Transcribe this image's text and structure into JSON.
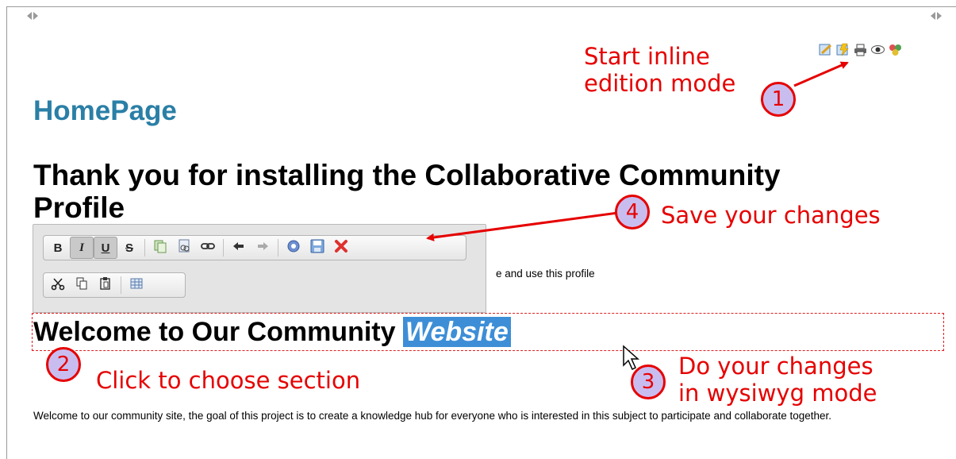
{
  "page": {
    "title": "HomePage",
    "heading1_line1": "Thank you for installing the Collaborative Community",
    "heading1_line2": "Profile",
    "paragraph1": "e and use this profile",
    "heading2": "Welcome to Our Community ",
    "heading2_highlight": "Website",
    "paragraph2": "Welcome to our community site, the goal of this project is to create a knowledge hub for everyone who is interested in this subject to participate and collaborate together."
  },
  "icons": {
    "collapse_left": "collapse-left-icon",
    "collapse_right": "collapse-right-icon",
    "page_actions": [
      "edit-icon",
      "inline-edit-icon",
      "print-icon",
      "view-icon",
      "tags-icon"
    ]
  },
  "toolbar": {
    "row1": [
      "B",
      "I",
      "U",
      "S"
    ],
    "row1_icons": [
      "copy-format-icon",
      "insert-image-icon",
      "link-icon",
      "undo-icon",
      "redo-icon",
      "help-icon",
      "save-icon",
      "cancel-icon"
    ],
    "row2_icons": [
      "cut-icon",
      "copy-icon",
      "paste-icon",
      "table-icon"
    ]
  },
  "annotations": {
    "a1_num": "1",
    "a1_line1": "Start inline",
    "a1_line2": "edition mode",
    "a2_num": "2",
    "a2_text": "Click to choose section",
    "a3_num": "3",
    "a3_line1": "Do your changes",
    "a3_line2": "in wysiwyg mode",
    "a4_num": "4",
    "a4_text": "Save your changes"
  },
  "colors": {
    "title": "#2a7fa6",
    "annotation": "#e60000",
    "circle_fill": "#c9bdf0",
    "highlight": "#3d8ed6"
  }
}
